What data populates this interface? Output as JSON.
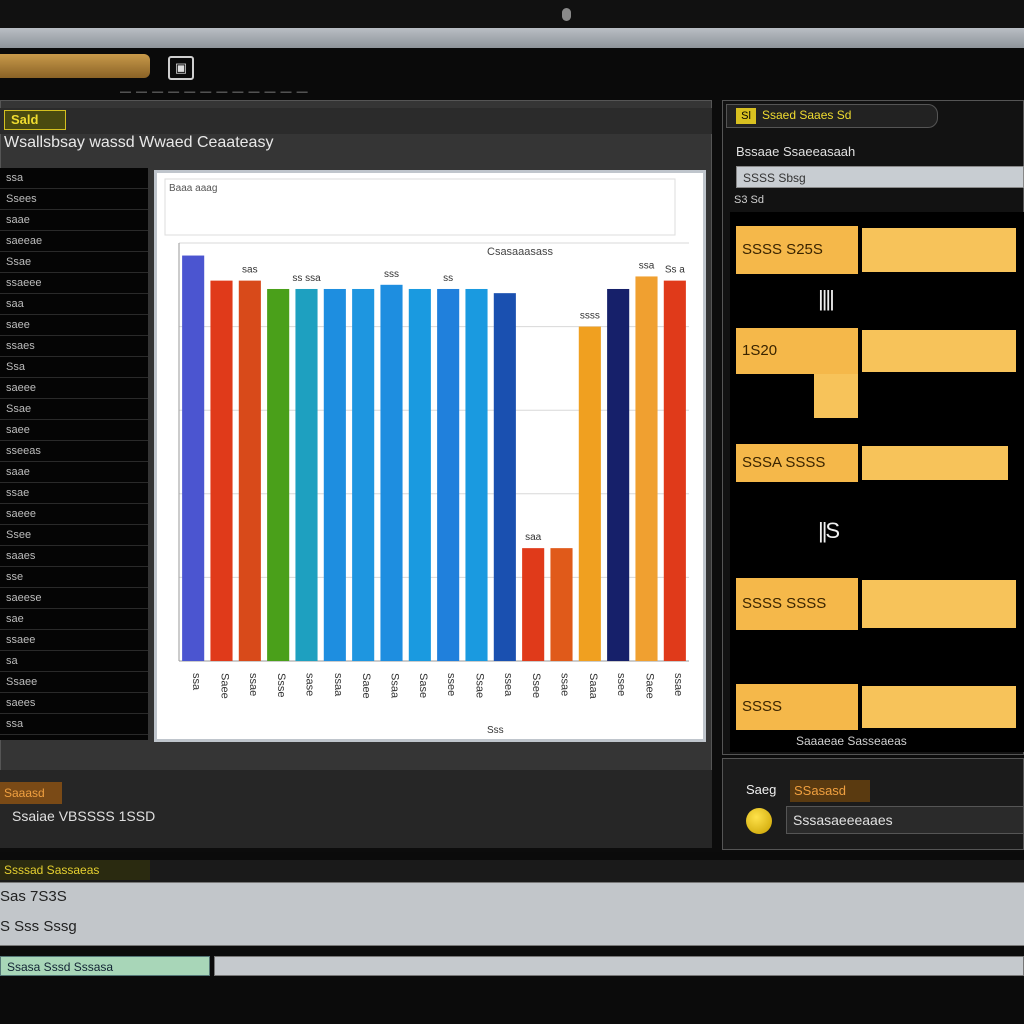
{
  "window": {
    "app_icon": "▣",
    "menu_text": "— — — — — — — — — — — —"
  },
  "main_panel": {
    "tag": "Sald",
    "title": "Wsallsbsay wassd Wwaed Ceaateasy",
    "left_list": [
      "ssa",
      "Ssees",
      "saae",
      "saeeae",
      "Ssae",
      "ssaeee",
      "saa",
      "saee",
      "ssaes",
      "Ssa",
      "saeee",
      "Ssae",
      "saee",
      "sseeas",
      "saae",
      "ssae",
      "saeee",
      "Ssee",
      "saaes",
      "sse",
      "saeese",
      "sae",
      "ssaee",
      "sa",
      "Ssaee",
      "saees",
      "ssa"
    ],
    "status_tag": "Saaasd",
    "status_text": "Ssaiae VBSSSS 1SSD"
  },
  "chart_data": {
    "type": "bar",
    "title": "Csasaaasass",
    "subtitle": "Baaa aaag",
    "categories": [
      "ssa",
      "Saee",
      "ssae",
      "Ssse",
      "sase",
      "ssaa",
      "Saee",
      "Ssaa",
      "Sase",
      "ssee",
      "Ssae",
      "ssea",
      "Ssee",
      "ssae",
      "Saaa",
      "ssee",
      "Saee",
      "ssae"
    ],
    "values": [
      97,
      91,
      91,
      89,
      89,
      89,
      89,
      90,
      89,
      89,
      89,
      88,
      27,
      27,
      80,
      89,
      92,
      91
    ],
    "colors": [
      "#4b55d0",
      "#e03a1a",
      "#d84a1a",
      "#4aa01a",
      "#1ea0c0",
      "#1e8ee0",
      "#1e96e0",
      "#1e8ee0",
      "#1a9ae0",
      "#2080dc",
      "#1a9ae0",
      "#1a50b0",
      "#e03a1a",
      "#e05a1a",
      "#f0a020",
      "#16206a",
      "#f0a030",
      "#e03a1a"
    ],
    "bar_labels": [
      "",
      "",
      "sas",
      "",
      "ss ssa",
      "",
      "",
      "sss",
      "",
      "ss",
      "",
      "",
      "saa",
      "",
      "ssss",
      "",
      "ssa",
      "Ss a"
    ],
    "ylim": [
      0,
      100
    ],
    "grid": true,
    "xlabel": "Sss"
  },
  "right_panel": {
    "tag": "Sl",
    "header": "Ssaed Saaes Sd",
    "subtitle": "Bssaae Ssaeeasaah",
    "input_value": "SSSS Sbsg",
    "sub2": "S3 Sd",
    "footer": "Saaaeae Sasseaeas",
    "rows": [
      {
        "label": "SSSS S25S",
        "bar_fraction": 0.95
      },
      {
        "label": "",
        "mark": "||||"
      },
      {
        "label": "1S20",
        "bar_fraction": 0.95
      },
      {
        "label": "",
        "small": true
      },
      {
        "label": "SSSA SSSS",
        "bar_fraction": 0.9
      },
      {
        "label": "",
        "mark": "||S"
      },
      {
        "label": "SSSS SSSS",
        "bar_fraction": 0.95
      },
      {
        "label": "SSSS",
        "bar_fraction": 0.95
      }
    ]
  },
  "right_bottom": {
    "label1": "Saeg",
    "label2": "SSasasd",
    "field": "Sssasaeeeaaes"
  },
  "console": {
    "tag": "Ssssad Sassaeas",
    "line1": "Sas 7S3S",
    "line2": "S Sss Sssg",
    "status_left": "Ssasa Sssd Sssasa"
  }
}
